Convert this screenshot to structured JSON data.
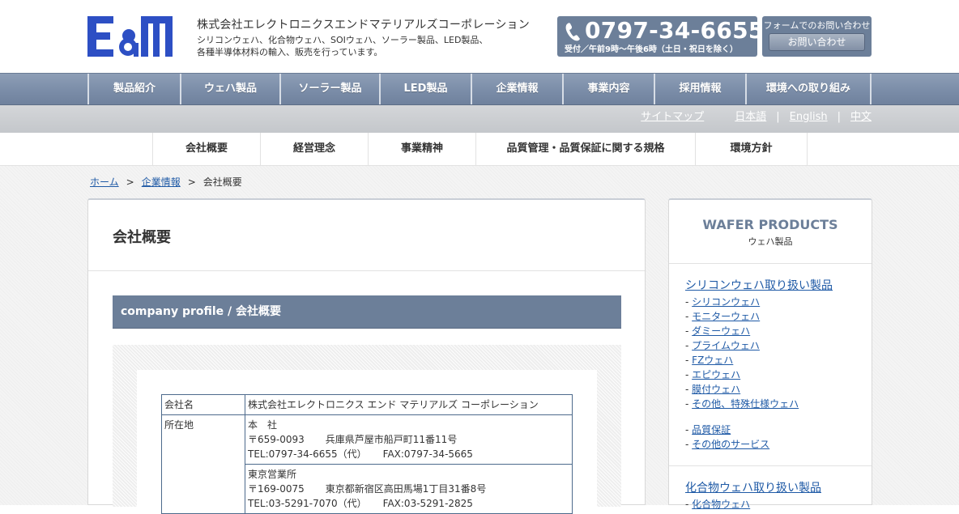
{
  "header": {
    "logo_text": "E&M",
    "company_name": "株式会社エレクトロニクスエンドマテリアルズコーポレーション",
    "description_lines": [
      "シリコンウェハ、化合物ウェハ、SOIウェハ、ソーラー製品、LED製品、",
      "各種半導体材料の輸入、販売を行っています。"
    ],
    "phone_number": "0797-34-6655",
    "phone_hours": "受付／午前9時〜午後6時（土日・祝日を除く）",
    "form_label": "フォームでのお問い合わせ",
    "form_button": "お問い合わせ"
  },
  "global_nav": [
    "製品紹介",
    "ウェハ製品",
    "ソーラー製品",
    "LED製品",
    "企業情報",
    "事業内容",
    "採用情報",
    "環境への取り組み"
  ],
  "util_links": {
    "sitemap": "サイトマップ",
    "languages": [
      "日本語",
      "English",
      "中文"
    ],
    "separator": "|"
  },
  "sub_nav": [
    "会社概要",
    "経営理念",
    "事業精神",
    "品質管理・品質保証に関する規格",
    "環境方針"
  ],
  "breadcrumb": {
    "home": "ホーム",
    "parent": "企業情報",
    "current": "会社概要",
    "arrow": ">"
  },
  "main": {
    "page_title": "会社概要",
    "section_title": "company profile / 会社概要",
    "profile": {
      "name_label": "会社名",
      "name_value": "株式会社エレクトロニクス エンド マテリアルズ コーポレーション",
      "address_label": "所在地",
      "head_office": {
        "title": "本　社",
        "postal": "〒659-0093",
        "address": "兵庫県芦屋市船戸町11番11号",
        "tel": "TEL:0797-34-6655（代）",
        "fax": "FAX:0797-34-5665"
      },
      "tokyo_office": {
        "title": "東京営業所",
        "postal": "〒169-0075",
        "address": "東京都新宿区高田馬場1丁目31番8号",
        "tel": "TEL:03-5291-7070（代）",
        "fax": "FAX:03-5291-2825"
      }
    }
  },
  "side": {
    "title": "WAFER PRODUCTS",
    "subtitle": "ウェハ製品",
    "group1_title": "シリコンウェハ取り扱い製品",
    "group1_items": [
      "シリコンウェハ",
      "モニターウェハ",
      "ダミーウェハ",
      "プライムウェハ",
      "FZウェハ",
      "エピウェハ",
      "膜付ウェハ",
      "その他、特殊仕様ウェハ"
    ],
    "group1_extra": [
      "品質保証",
      "その他のサービス"
    ],
    "group2_title": "化合物ウェハ取り扱い製品",
    "group2_items": [
      "化合物ウェハ"
    ],
    "bullet": "-"
  },
  "colors": {
    "brand_blue": "#2d4fc4",
    "nav_slate": "#7b8da8",
    "panel_header": "#6c7f99",
    "link": "#1f5aa6"
  }
}
